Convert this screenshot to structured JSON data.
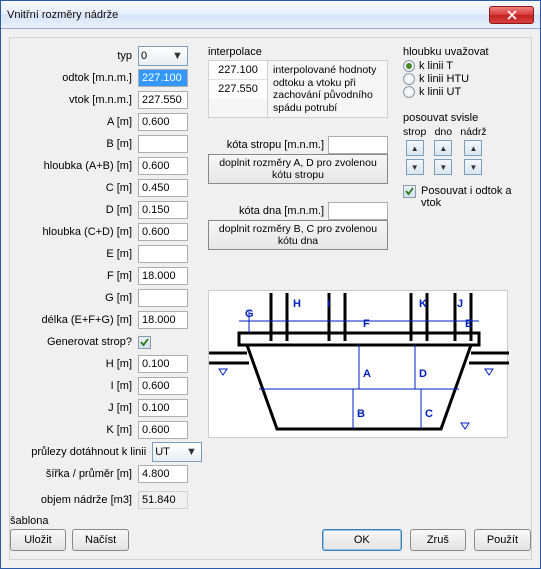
{
  "window_title": "Vnitřní rozměry nádrže",
  "fields": {
    "typ": {
      "label": "typ",
      "value": "0"
    },
    "odtok": {
      "label": "odtok [m.n.m.]",
      "value": "227.100"
    },
    "vtok": {
      "label": "vtok [m.n.m.]",
      "value": "227.550"
    },
    "A": {
      "label": "A [m]",
      "value": "0.600"
    },
    "B": {
      "label": "B [m]",
      "value": ""
    },
    "hAB": {
      "label": "hloubka (A+B) [m]",
      "value": "0.600"
    },
    "C": {
      "label": "C [m]",
      "value": "0.450"
    },
    "D": {
      "label": "D [m]",
      "value": "0.150"
    },
    "hCD": {
      "label": "hloubka (C+D) [m]",
      "value": "0.600"
    },
    "E": {
      "label": "E [m]",
      "value": ""
    },
    "F": {
      "label": "F [m]",
      "value": "18.000"
    },
    "G": {
      "label": "G [m]",
      "value": ""
    },
    "delka": {
      "label": "délka (E+F+G) [m]",
      "value": "18.000"
    },
    "genstrop": {
      "label": "Generovat strop?",
      "checked": true
    },
    "H": {
      "label": "H [m]",
      "value": "0.100"
    },
    "I": {
      "label": "I [m]",
      "value": "0.600"
    },
    "J": {
      "label": "J [m]",
      "value": "0.100"
    },
    "K": {
      "label": "K [m]",
      "value": "0.600"
    },
    "prulezy": {
      "label": "průlezy dotáhnout k linii",
      "value": "UT"
    },
    "sirka": {
      "label": "šířka / průměr [m]",
      "value": "4.800"
    },
    "objem": {
      "label": "objem nádrže [m3]",
      "value": "51.840"
    }
  },
  "interpolace": {
    "head": "interpolace",
    "val1": "227.100",
    "val2": "227.550",
    "desc": "interpolované hodnoty odtoku a vtoku při zachování původního spádu potrubí"
  },
  "kota_strop": {
    "label": "kóta stropu [m.n.m.]",
    "value": "",
    "btn": "doplnit rozměry A, D pro zvolenou kótu stropu"
  },
  "kota_dna": {
    "label": "kóta dna [m.n.m.]",
    "value": "",
    "btn": "doplnit rozměry B, C pro zvolenou kótu dna"
  },
  "hloubku": {
    "head": "hloubku uvažovat",
    "opts": [
      "k linii T",
      "k linii HTU",
      "k linii UT"
    ],
    "selected": 0
  },
  "posouvat": {
    "head": "posouvat svisle",
    "cols": [
      "strop",
      "dno",
      "nádrž"
    ],
    "check_label": "Posouvat i odtok a vtok",
    "checked": true
  },
  "diagram_labels": {
    "G": "G",
    "H": "H",
    "I": "I",
    "F": "F",
    "K": "K",
    "J": "J",
    "E": "E",
    "A": "A",
    "D": "D",
    "B": "B",
    "C": "C"
  },
  "sablona": {
    "head": "šablona",
    "save": "Uložit",
    "load": "Načíst"
  },
  "buttons": {
    "ok": "OK",
    "cancel": "Zruš",
    "apply": "Použít"
  }
}
